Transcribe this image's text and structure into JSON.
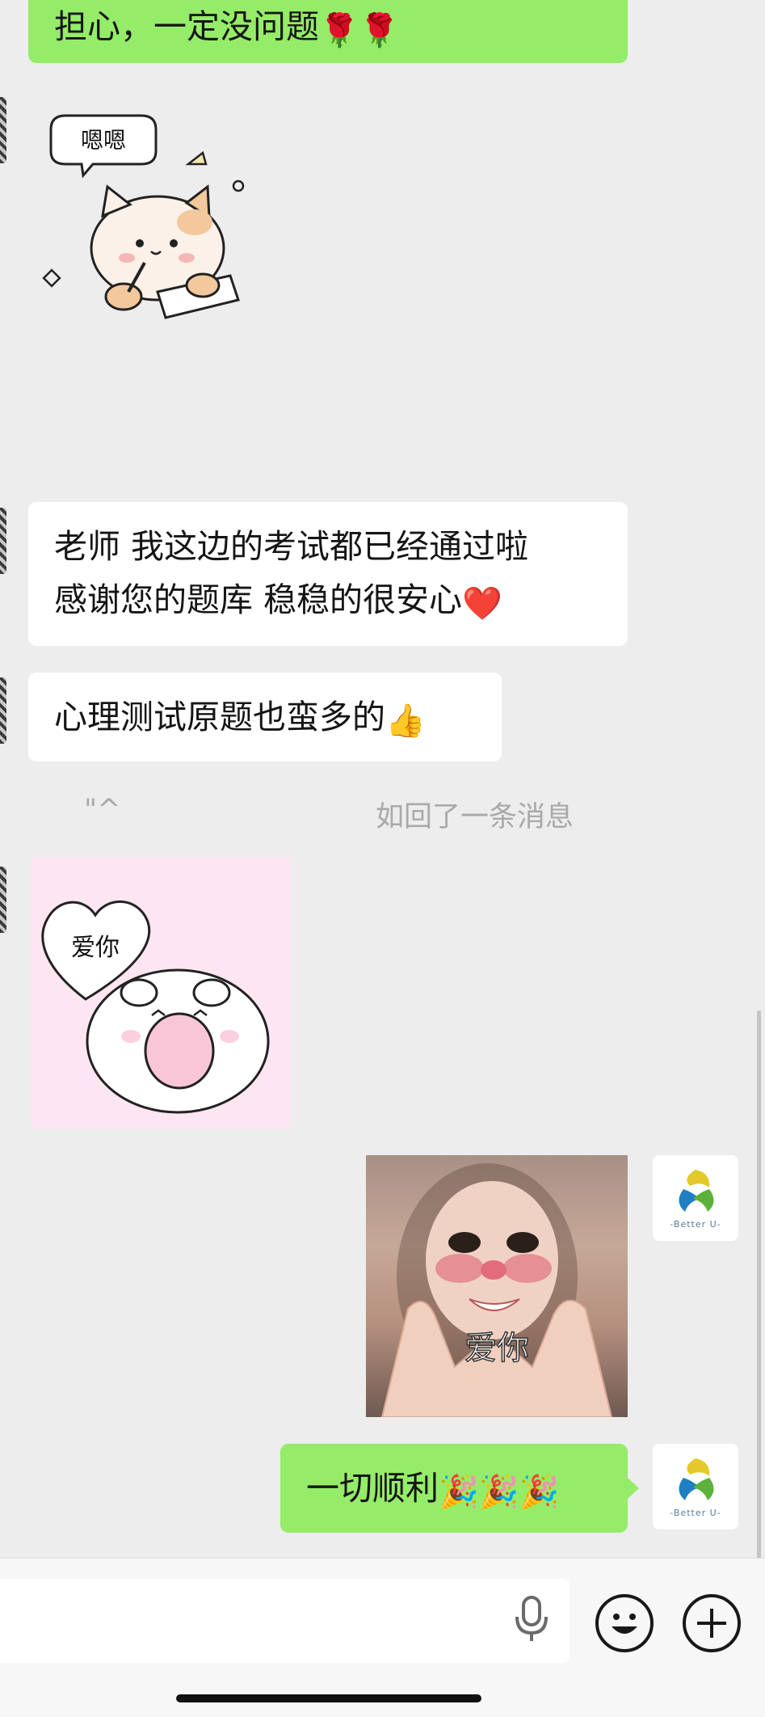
{
  "messages": {
    "m1": {
      "text": "担心，一定没问题",
      "emoji": "🌹🌹"
    },
    "m2_sticker_text": "嗯嗯",
    "m3": {
      "line1": "老师 我这边的考试都已经通过啦",
      "line2": "感谢您的题库 稳稳的很安心",
      "emoji": "❤️"
    },
    "m4": {
      "text": "心理测试原题也蛮多的",
      "emoji": "👍"
    },
    "notice": {
      "quote": "\"^",
      "text": "如回了一条消息"
    },
    "m5_sticker_text": "爱你",
    "m6_sticker_caption": "爱你",
    "m7": {
      "text": "一切顺利",
      "emoji": "🎉🎉🎉"
    }
  },
  "self_avatar": {
    "brand": "-Better U-"
  },
  "input": {
    "placeholder": ""
  },
  "colors": {
    "background": "#ededed",
    "outgoing": "#95ec69",
    "incoming": "#ffffff"
  }
}
